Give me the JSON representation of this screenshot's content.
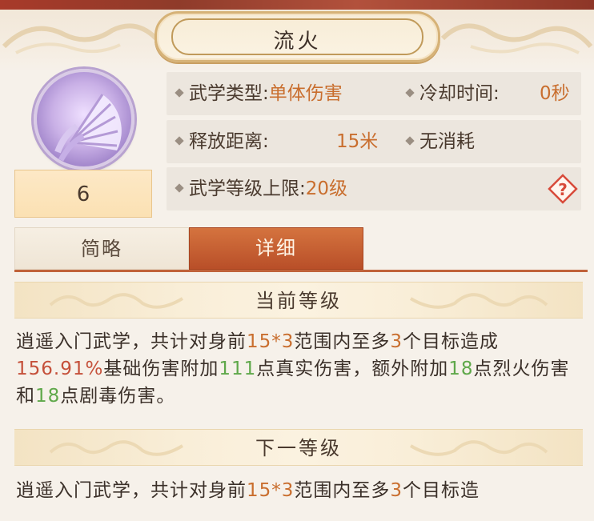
{
  "title": "流火",
  "skill_level": "6",
  "info": {
    "type_label": "武学类型:",
    "type_value": "单体伤害",
    "cooldown_label": "冷却时间:",
    "cooldown_value": "0秒",
    "range_label": "释放距离:",
    "range_value": "15米",
    "cost_text": "无消耗",
    "max_level_label": "武学等级上限:",
    "max_level_value": "20级"
  },
  "help_symbol": "?",
  "tabs": [
    {
      "label": "简略",
      "active": false
    },
    {
      "label": "详细",
      "active": true
    }
  ],
  "current_level": {
    "heading": "当前等级",
    "segments": [
      {
        "text": "逍遥入门武学，共计对身前",
        "color": "normal"
      },
      {
        "text": "15*3",
        "color": "orange"
      },
      {
        "text": "范围内至多",
        "color": "normal"
      },
      {
        "text": "3",
        "color": "orange"
      },
      {
        "text": "个目标造成",
        "color": "normal"
      },
      {
        "text": "156.91%",
        "color": "red"
      },
      {
        "text": "基础伤害附加",
        "color": "normal"
      },
      {
        "text": "111",
        "color": "green"
      },
      {
        "text": "点真实伤害，额外附加",
        "color": "normal"
      },
      {
        "text": "18",
        "color": "green"
      },
      {
        "text": "点烈火伤害和",
        "color": "normal"
      },
      {
        "text": "18",
        "color": "green"
      },
      {
        "text": "点剧毒伤害。",
        "color": "normal"
      }
    ]
  },
  "next_level": {
    "heading": "下一等级",
    "segments": [
      {
        "text": "逍遥入门武学，共计对身前",
        "color": "normal"
      },
      {
        "text": "15*3",
        "color": "orange"
      },
      {
        "text": "范围内至多",
        "color": "normal"
      },
      {
        "text": "3",
        "color": "orange"
      },
      {
        "text": "个目标造",
        "color": "normal"
      }
    ]
  },
  "colors": {
    "accent_orange": "#c96e2e",
    "damage_red": "#c5503a",
    "value_green": "#5fa84a",
    "tab_active": "#c0623a",
    "help_red": "#d84a3a"
  }
}
